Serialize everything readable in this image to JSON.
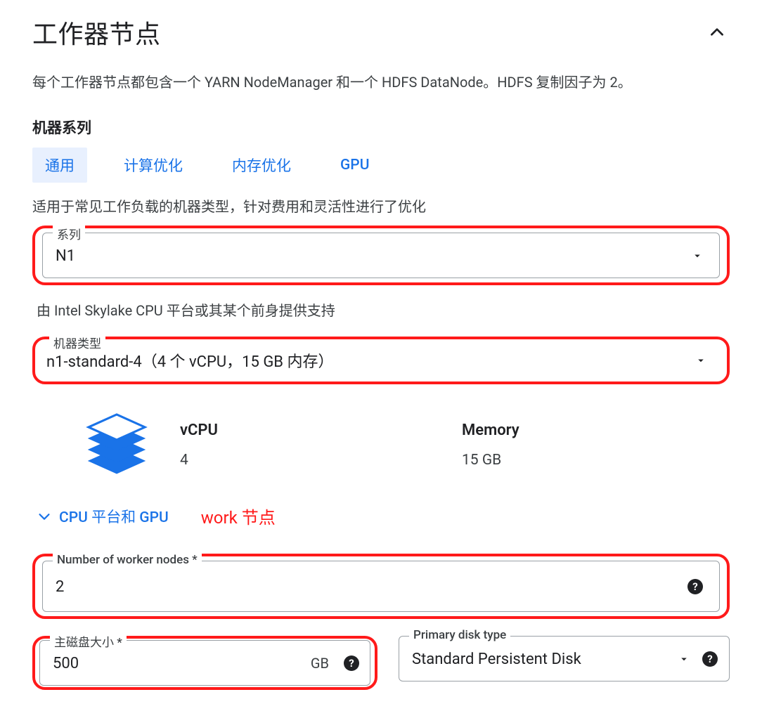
{
  "section": {
    "title": "工作器节点",
    "description": "每个工作器节点都包含一个 YARN NodeManager 和一个 HDFS DataNode。HDFS 复制因子为 2。"
  },
  "machine_series": {
    "label": "机器系列",
    "tabs": [
      "通用",
      "计算优化",
      "内存优化",
      "GPU"
    ],
    "active_index": 0,
    "helper": "适用于常见工作负载的机器类型，针对费用和灵活性进行了优化"
  },
  "series_field": {
    "label": "系列",
    "value": "N1",
    "note": "由 Intel Skylake CPU 平台或其某个前身提供支持"
  },
  "machine_type_field": {
    "label": "机器类型",
    "value": "n1-standard-4（4 个 vCPU，15 GB 内存）"
  },
  "specs": {
    "vcpu_label": "vCPU",
    "vcpu_value": "4",
    "memory_label": "Memory",
    "memory_value": "15 GB"
  },
  "cpu_gpu_expander": "CPU 平台和 GPU",
  "annotation": "work 节点",
  "worker_count_field": {
    "label": "Number of worker nodes *",
    "value": "2"
  },
  "disk_size_field": {
    "label": "主磁盘大小 *",
    "value": "500",
    "unit": "GB"
  },
  "disk_type_field": {
    "label": "Primary disk type",
    "value": "Standard Persistent Disk"
  }
}
